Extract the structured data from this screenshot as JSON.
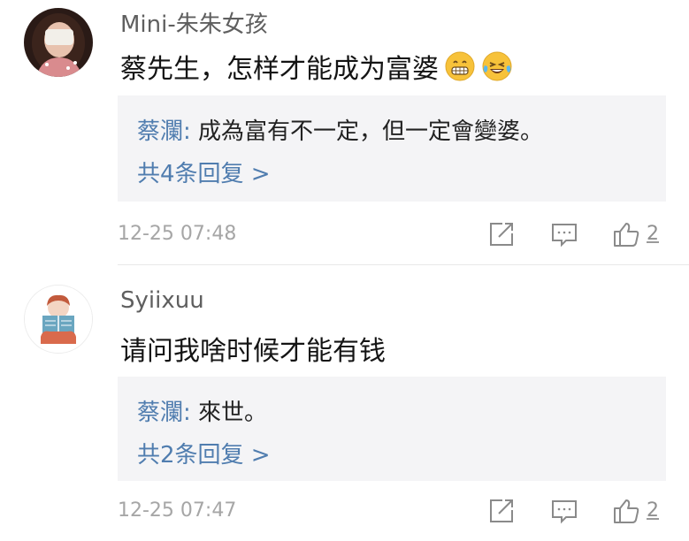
{
  "comments": [
    {
      "username": "Mini-朱朱女孩",
      "text": "蔡先生，怎样才能成为富婆",
      "emojis": [
        "grinning-face-icon",
        "tears-of-joy-icon"
      ],
      "reply_preview": {
        "author": "蔡瀾",
        "separator": ": ",
        "text": "成為富有不一定，但一定會變婆。"
      },
      "reply_count_label": "共4条回复 >",
      "timestamp": "12-25 07:48",
      "like_count": "2"
    },
    {
      "username": "Syiixuu",
      "text": "请问我啥时候才能有钱",
      "reply_preview": {
        "author": "蔡瀾",
        "separator": ": ",
        "text": "來世。"
      },
      "reply_count_label": "共2条回复 >",
      "timestamp": "12-25 07:47",
      "like_count": "2"
    }
  ],
  "icons": {
    "share": "share-icon",
    "reply": "comment-icon",
    "like": "thumbs-up-icon"
  },
  "colors": {
    "link": "#507daf",
    "reply_background": "#f4f4f6",
    "meta_text": "#a6a6a6"
  }
}
